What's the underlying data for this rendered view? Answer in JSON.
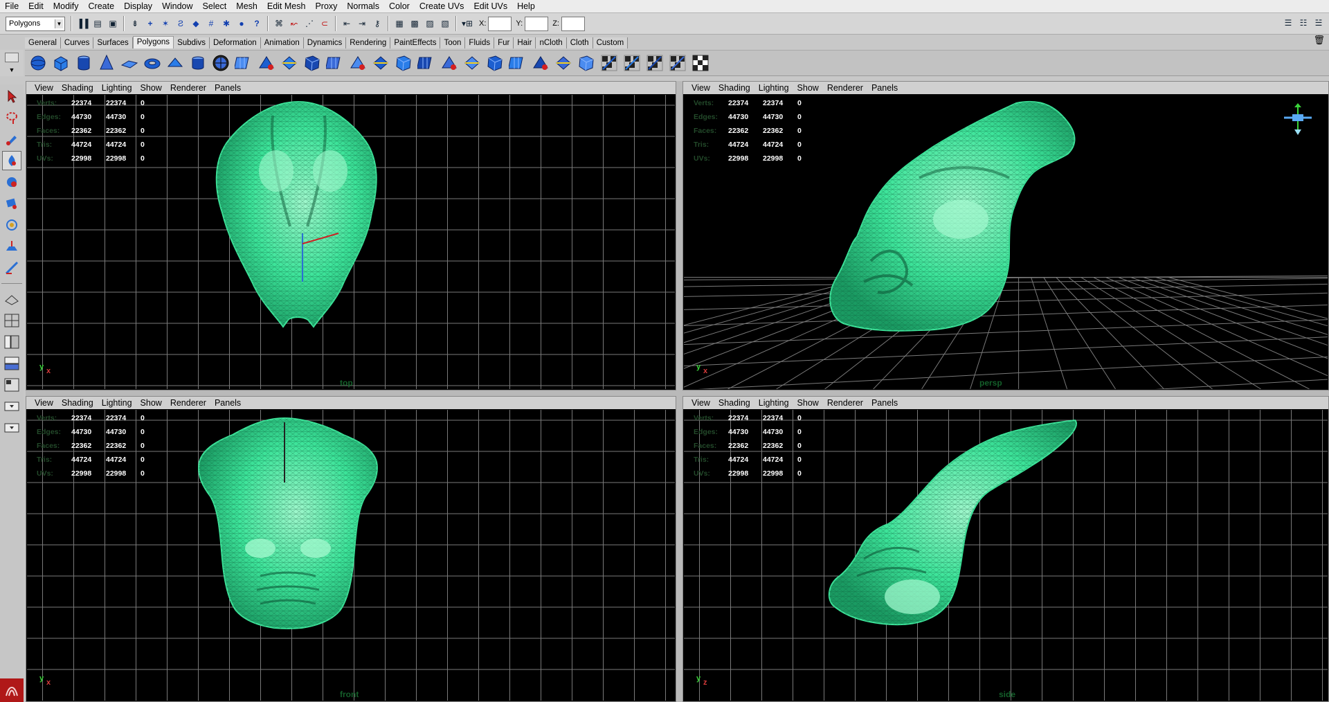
{
  "menubar": [
    "File",
    "Edit",
    "Modify",
    "Create",
    "Display",
    "Window",
    "Select",
    "Mesh",
    "Edit Mesh",
    "Proxy",
    "Normals",
    "Color",
    "Create UVs",
    "Edit UVs",
    "Help"
  ],
  "status": {
    "mode": "Polygons",
    "x_label": "X:",
    "y_label": "Y:",
    "z_label": "Z:",
    "x_value": "",
    "y_value": "",
    "z_value": ""
  },
  "shelf_tabs": [
    "General",
    "Curves",
    "Surfaces",
    "Polygons",
    "Subdivs",
    "Deformation",
    "Animation",
    "Dynamics",
    "Rendering",
    "PaintEffects",
    "Toon",
    "Fluids",
    "Fur",
    "Hair",
    "nCloth",
    "Cloth",
    "Custom"
  ],
  "active_shelf": "Polygons",
  "shelf_icon_names": [
    "poly-sphere-icon",
    "poly-cube-icon",
    "poly-cylinder-icon",
    "poly-cone-icon",
    "poly-plane-icon",
    "poly-torus-icon",
    "poly-prism-icon",
    "poly-pipe-icon",
    "poly-soccer-icon",
    "combine-icon",
    "separate-icon",
    "smooth-icon",
    "smooth-proxy-icon",
    "bevel-icon",
    "extrude-icon",
    "bridge-icon",
    "append-icon",
    "merge-icon",
    "split-icon",
    "insert-edge-loop-icon",
    "offset-loop-icon",
    "wedge-icon",
    "poke-icon",
    "chamfer-icon",
    "planar-map-icon",
    "cylindrical-map-icon",
    "spherical-map-icon",
    "automatic-map-icon",
    "uv-editor-icon",
    "checker-icon"
  ],
  "pane_menu": [
    "View",
    "Shading",
    "Lighting",
    "Show",
    "Renderer",
    "Panels"
  ],
  "hud": {
    "labels": [
      "Verts:",
      "Edges:",
      "Faces:",
      "Tris:",
      "UVs:"
    ],
    "rows": [
      [
        "22374",
        "22374",
        "0"
      ],
      [
        "44730",
        "44730",
        "0"
      ],
      [
        "22362",
        "22362",
        "0"
      ],
      [
        "44724",
        "44724",
        "0"
      ],
      [
        "22998",
        "22998",
        "0"
      ]
    ]
  },
  "viewports": [
    {
      "name": "top",
      "camera": "top",
      "axes": [
        "y",
        "x"
      ]
    },
    {
      "name": "persp",
      "camera": "persp",
      "axes": [
        "y",
        "x"
      ]
    },
    {
      "name": "front",
      "camera": "front",
      "axes": [
        "y",
        "x"
      ]
    },
    {
      "name": "side",
      "camera": "side",
      "axes": [
        "y",
        "z"
      ]
    }
  ],
  "colors": {
    "mesh": "#3de49a",
    "mesh_light": "#9ff7cc",
    "grid": "#7a7a7a",
    "viewport_bg": "#000000",
    "hud_label": "#234a2a",
    "cam_label": "#145f2a"
  }
}
